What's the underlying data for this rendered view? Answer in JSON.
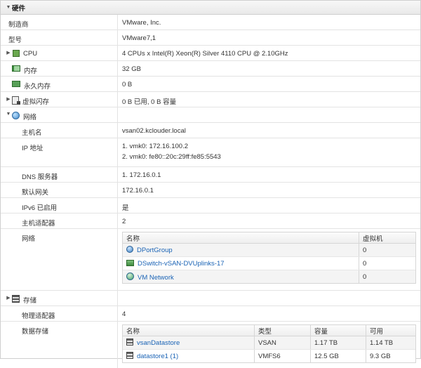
{
  "section": {
    "title": "硬件",
    "toggle": "▼"
  },
  "rows": {
    "vendor": {
      "label": "制造商",
      "value": "VMware, Inc."
    },
    "model": {
      "label": "型号",
      "value": "VMware7,1"
    },
    "cpu": {
      "label": "CPU",
      "value": "4 CPUs x Intel(R) Xeon(R) Silver 4110 CPU @ 2.10GHz"
    },
    "memory": {
      "label": "内存",
      "value": "32 GB"
    },
    "persistent_memory": {
      "label": "永久内存",
      "value": "0 B"
    },
    "virtual_flash": {
      "label": "虚拟闪存",
      "value": "0 B 已用, 0 B 容量"
    },
    "network": {
      "label": "网络"
    },
    "hostname": {
      "label": "主机名",
      "value": "vsan02.kclouder.local"
    },
    "ip": {
      "label": "IP 地址",
      "line1": "1. vmk0: 172.16.100.2",
      "line2": "2. vmk0: fe80::20c:29ff:fe85:5543"
    },
    "dns": {
      "label": "DNS 服务器",
      "value": "1. 172.16.0.1"
    },
    "gateway": {
      "label": "默认网关",
      "value": "172.16.0.1"
    },
    "ipv6": {
      "label": "IPv6 已启用",
      "value": "是"
    },
    "host_adapters": {
      "label": "主机适配器",
      "value": "2"
    },
    "networks": {
      "label": "网络"
    },
    "storage": {
      "label": "存储"
    },
    "physical_adapters": {
      "label": "物理适配器",
      "value": "4"
    },
    "datastores": {
      "label": "数据存储"
    }
  },
  "network_table": {
    "headers": {
      "name": "名称",
      "vms": "虚拟机"
    },
    "rows": [
      {
        "name": "DPortGroup",
        "vms": "0",
        "icon": "portgroup-icon"
      },
      {
        "name": "DSwitch-vSAN-DVUplinks-17",
        "vms": "0",
        "icon": "uplink-icon"
      },
      {
        "name": "VM Network",
        "vms": "0",
        "icon": "vm-network-icon"
      }
    ]
  },
  "datastore_table": {
    "headers": {
      "name": "名称",
      "type": "类型",
      "capacity": "容量",
      "free": "可用"
    },
    "rows": [
      {
        "name": "vsanDatastore",
        "type": "VSAN",
        "capacity": "1.17 TB",
        "free": "1.14 TB"
      },
      {
        "name": "datastore1 (1)",
        "type": "VMFS6",
        "capacity": "12.5 GB",
        "free": "9.3 GB"
      }
    ]
  }
}
